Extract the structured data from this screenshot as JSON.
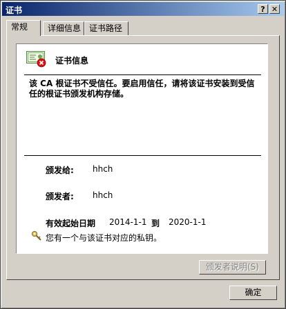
{
  "window": {
    "title": "证书",
    "help_btn": "?",
    "close_btn": "✕"
  },
  "tabs": [
    {
      "label": "常规"
    },
    {
      "label": "详细信息"
    },
    {
      "label": "证书路径"
    }
  ],
  "info": {
    "heading": "证书信息",
    "warning": "该 CA 根证书不受信任。要启用信任，请将该证书安装到受信任的根证书颁发机构存储。",
    "issued_to_label": "颁发给:",
    "issued_to_value": "hhch",
    "issued_by_label": "颁发者:",
    "issued_by_value": "hhch",
    "valid_label": "有效起始日期",
    "valid_from": "2014-1-1",
    "valid_to_label": "到",
    "valid_to": "2020-1-1",
    "private_key_text": "您有一个与该证书对应的私钥。"
  },
  "buttons": {
    "issuer_statement": "颁发者说明(S)",
    "ok": "确定"
  },
  "colors": {
    "title_start": "#0a246a",
    "title_end": "#a6caf0",
    "face": "#d4d0c8"
  }
}
